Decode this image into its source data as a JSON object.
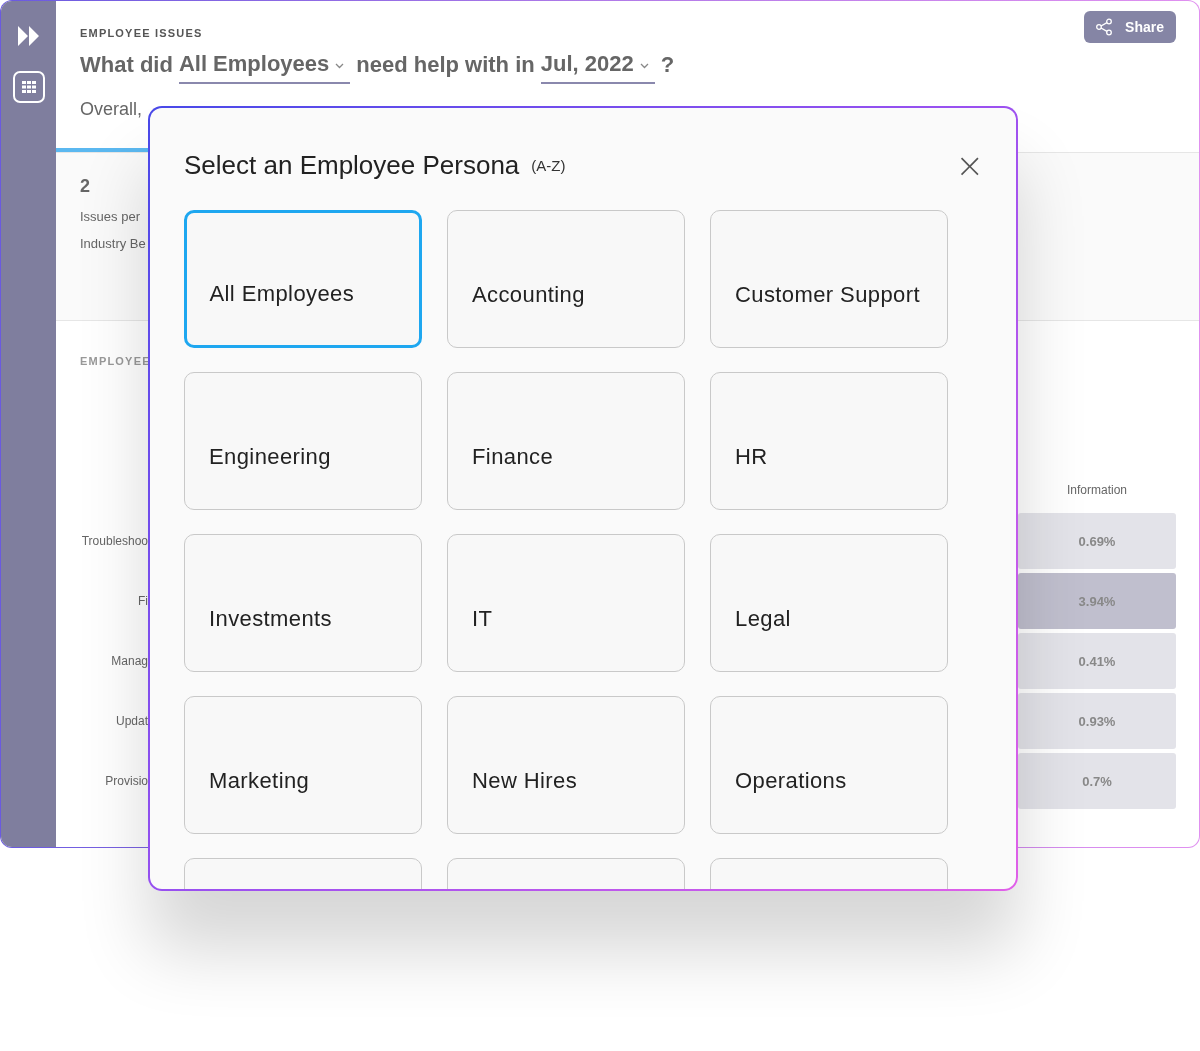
{
  "section_label": "EMPLOYEE ISSUES",
  "question": [
    {
      "kind": "text",
      "text": "What did"
    },
    {
      "kind": "dropdown",
      "text": "All Employees"
    },
    {
      "kind": "text",
      "text": "need help with in"
    },
    {
      "kind": "dropdown",
      "text": "Jul, 2022"
    },
    {
      "kind": "text",
      "text": "?"
    }
  ],
  "share_button": "Share",
  "overall_text": "Overall,",
  "stats": {
    "value": "2",
    "lines": [
      "Issues per",
      "Industry Be"
    ]
  },
  "heatmap": {
    "title": "EMPLOYEE",
    "column": "Information",
    "rows": [
      {
        "label": "Troubleshoo",
        "value": "0.69%",
        "color": "#e3e3e9"
      },
      {
        "label": "Fi",
        "value": "3.94%",
        "color": "#c0bfce"
      },
      {
        "label": "Manag",
        "value": "0.41%",
        "color": "#e3e3e9"
      },
      {
        "label": "Updat",
        "value": "0.93%",
        "color": "#e3e3e9"
      },
      {
        "label": "Provisio",
        "value": "0.7%",
        "color": "#e3e3e9"
      }
    ]
  },
  "modal": {
    "title": "Select an Employee Persona",
    "sort_hint": "(A-Z)",
    "close": "×",
    "personas": [
      {
        "kind": "card",
        "label": "All Employees",
        "selected": true
      },
      {
        "kind": "card",
        "label": "Accounting",
        "selected": false
      },
      {
        "kind": "card",
        "label": "Customer Support",
        "selected": false
      },
      {
        "kind": "card",
        "label": "Engineering",
        "selected": false
      },
      {
        "kind": "card",
        "label": "Finance",
        "selected": false
      },
      {
        "kind": "card",
        "label": "HR",
        "selected": false
      },
      {
        "kind": "card",
        "label": "Investments",
        "selected": false
      },
      {
        "kind": "card",
        "label": "IT",
        "selected": false
      },
      {
        "kind": "card",
        "label": "Legal",
        "selected": false
      },
      {
        "kind": "card",
        "label": "Marketing",
        "selected": false
      },
      {
        "kind": "card",
        "label": "New Hires",
        "selected": false
      },
      {
        "kind": "card",
        "label": "Operations",
        "selected": false
      },
      {
        "kind": "cut",
        "selected": false
      },
      {
        "kind": "cut",
        "selected": false
      },
      {
        "kind": "cut",
        "selected": false
      }
    ]
  }
}
